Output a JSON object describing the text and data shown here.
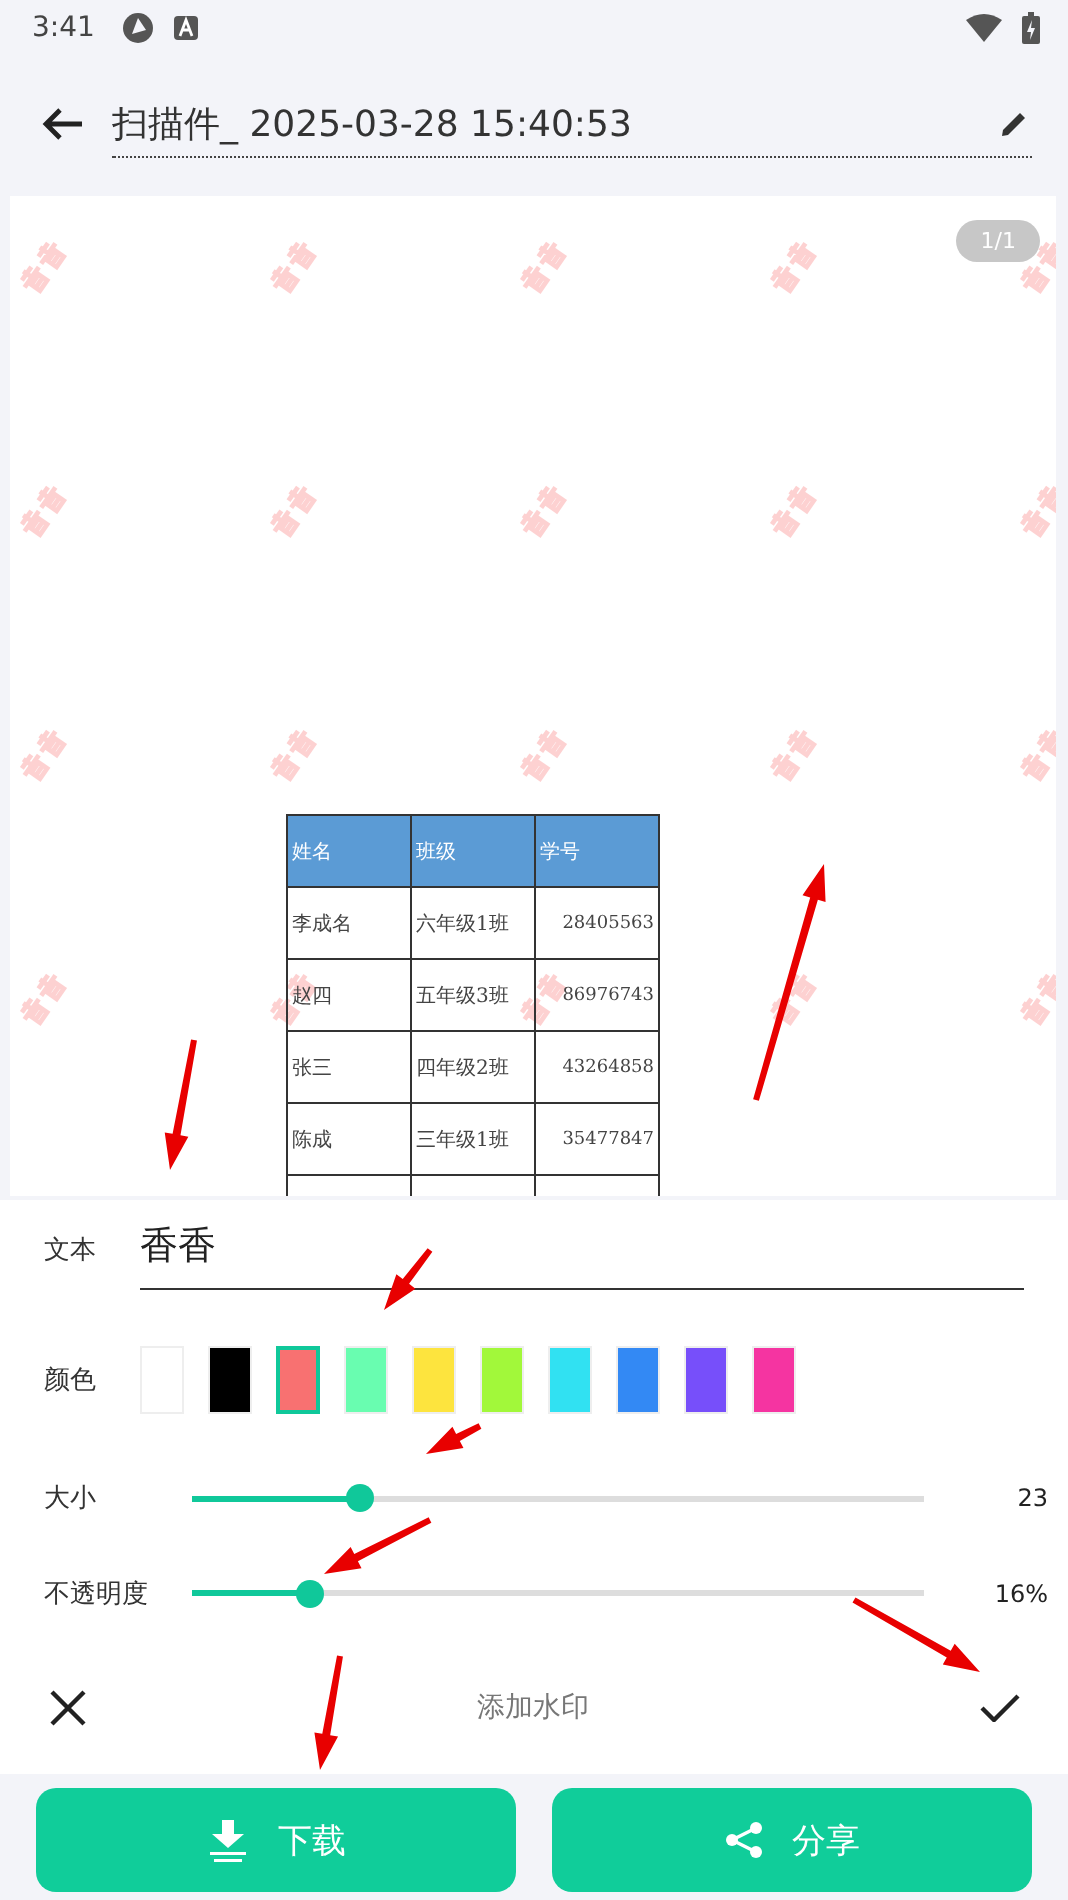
{
  "status_bar": {
    "time": "3:41"
  },
  "title_bar": {
    "title": "扫描件_ 2025-03-28 15:40:53"
  },
  "preview": {
    "page_indicator": "1/1",
    "table": {
      "columns": [
        "姓名",
        "班级",
        "学号"
      ],
      "rows": [
        [
          "李成名",
          "六年级1班",
          "28405563"
        ],
        [
          "赵四",
          "五年级3班",
          "86976743"
        ],
        [
          "张三",
          "四年级2班",
          "43264858"
        ],
        [
          "陈成",
          "三年级1班",
          "35477847"
        ]
      ]
    }
  },
  "editor": {
    "text_label": "文本",
    "text_value": "香香",
    "color_label": "颜色",
    "colors": [
      {
        "color": "#ffffff",
        "selected": false
      },
      {
        "color": "#000000",
        "selected": false
      },
      {
        "color": "#f87171",
        "selected": true
      },
      {
        "color": "#69fdb0",
        "selected": false
      },
      {
        "color": "#fde43e",
        "selected": false
      },
      {
        "color": "#a2f83a",
        "selected": false
      },
      {
        "color": "#31e1f2",
        "selected": false
      },
      {
        "color": "#3389f4",
        "selected": false
      },
      {
        "color": "#774ffa",
        "selected": false
      },
      {
        "color": "#f534a1",
        "selected": false
      }
    ],
    "sliders": [
      {
        "label": "大小",
        "level": 0.23,
        "reading": "23"
      },
      {
        "label": "不透明度",
        "level": 0.16,
        "reading": "16%"
      }
    ],
    "title": "添加水印"
  },
  "buttons": [
    {
      "label": "下载",
      "kind": "download"
    },
    {
      "label": "分享",
      "kind": "share"
    }
  ]
}
